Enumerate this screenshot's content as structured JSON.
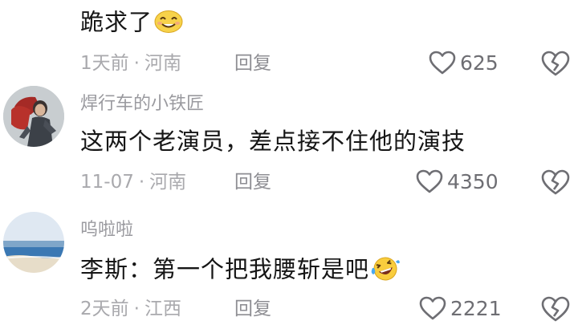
{
  "comments": [
    {
      "text": "跪求了",
      "emoji_icon": "smiling-face-icon",
      "time": "1天前",
      "location": "河南",
      "reply_label": "回复",
      "likes": "625"
    },
    {
      "username": "焊行车的小铁匠",
      "text": "这两个老演员，差点接不住他的演技",
      "time": "11-07",
      "location": "河南",
      "reply_label": "回复",
      "likes": "4350"
    },
    {
      "username": "呜啦啦",
      "text": "李斯：第一个把我腰斩是吧",
      "emoji_icon": "laughing-tears-face-icon",
      "time": "2天前",
      "location": "江西",
      "reply_label": "回复",
      "likes": "2221"
    }
  ],
  "separator": "·",
  "icons": {
    "like": "heart-outline-icon",
    "dislike": "broken-heart-icon"
  }
}
